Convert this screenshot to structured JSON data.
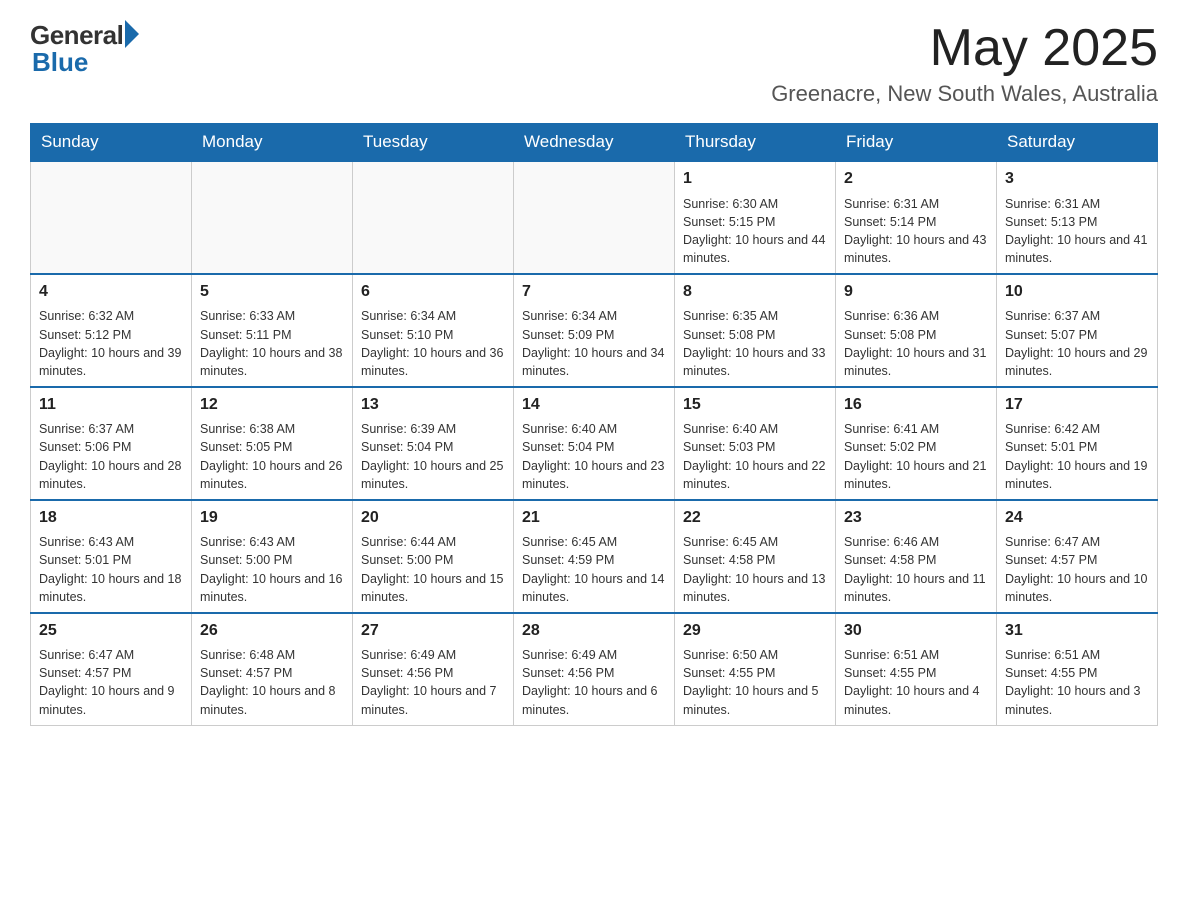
{
  "header": {
    "logo_general": "General",
    "logo_blue": "Blue",
    "month_title": "May 2025",
    "subtitle": "Greenacre, New South Wales, Australia"
  },
  "weekdays": [
    "Sunday",
    "Monday",
    "Tuesday",
    "Wednesday",
    "Thursday",
    "Friday",
    "Saturday"
  ],
  "weeks": [
    [
      {
        "day": "",
        "info": ""
      },
      {
        "day": "",
        "info": ""
      },
      {
        "day": "",
        "info": ""
      },
      {
        "day": "",
        "info": ""
      },
      {
        "day": "1",
        "info": "Sunrise: 6:30 AM\nSunset: 5:15 PM\nDaylight: 10 hours and 44 minutes."
      },
      {
        "day": "2",
        "info": "Sunrise: 6:31 AM\nSunset: 5:14 PM\nDaylight: 10 hours and 43 minutes."
      },
      {
        "day": "3",
        "info": "Sunrise: 6:31 AM\nSunset: 5:13 PM\nDaylight: 10 hours and 41 minutes."
      }
    ],
    [
      {
        "day": "4",
        "info": "Sunrise: 6:32 AM\nSunset: 5:12 PM\nDaylight: 10 hours and 39 minutes."
      },
      {
        "day": "5",
        "info": "Sunrise: 6:33 AM\nSunset: 5:11 PM\nDaylight: 10 hours and 38 minutes."
      },
      {
        "day": "6",
        "info": "Sunrise: 6:34 AM\nSunset: 5:10 PM\nDaylight: 10 hours and 36 minutes."
      },
      {
        "day": "7",
        "info": "Sunrise: 6:34 AM\nSunset: 5:09 PM\nDaylight: 10 hours and 34 minutes."
      },
      {
        "day": "8",
        "info": "Sunrise: 6:35 AM\nSunset: 5:08 PM\nDaylight: 10 hours and 33 minutes."
      },
      {
        "day": "9",
        "info": "Sunrise: 6:36 AM\nSunset: 5:08 PM\nDaylight: 10 hours and 31 minutes."
      },
      {
        "day": "10",
        "info": "Sunrise: 6:37 AM\nSunset: 5:07 PM\nDaylight: 10 hours and 29 minutes."
      }
    ],
    [
      {
        "day": "11",
        "info": "Sunrise: 6:37 AM\nSunset: 5:06 PM\nDaylight: 10 hours and 28 minutes."
      },
      {
        "day": "12",
        "info": "Sunrise: 6:38 AM\nSunset: 5:05 PM\nDaylight: 10 hours and 26 minutes."
      },
      {
        "day": "13",
        "info": "Sunrise: 6:39 AM\nSunset: 5:04 PM\nDaylight: 10 hours and 25 minutes."
      },
      {
        "day": "14",
        "info": "Sunrise: 6:40 AM\nSunset: 5:04 PM\nDaylight: 10 hours and 23 minutes."
      },
      {
        "day": "15",
        "info": "Sunrise: 6:40 AM\nSunset: 5:03 PM\nDaylight: 10 hours and 22 minutes."
      },
      {
        "day": "16",
        "info": "Sunrise: 6:41 AM\nSunset: 5:02 PM\nDaylight: 10 hours and 21 minutes."
      },
      {
        "day": "17",
        "info": "Sunrise: 6:42 AM\nSunset: 5:01 PM\nDaylight: 10 hours and 19 minutes."
      }
    ],
    [
      {
        "day": "18",
        "info": "Sunrise: 6:43 AM\nSunset: 5:01 PM\nDaylight: 10 hours and 18 minutes."
      },
      {
        "day": "19",
        "info": "Sunrise: 6:43 AM\nSunset: 5:00 PM\nDaylight: 10 hours and 16 minutes."
      },
      {
        "day": "20",
        "info": "Sunrise: 6:44 AM\nSunset: 5:00 PM\nDaylight: 10 hours and 15 minutes."
      },
      {
        "day": "21",
        "info": "Sunrise: 6:45 AM\nSunset: 4:59 PM\nDaylight: 10 hours and 14 minutes."
      },
      {
        "day": "22",
        "info": "Sunrise: 6:45 AM\nSunset: 4:58 PM\nDaylight: 10 hours and 13 minutes."
      },
      {
        "day": "23",
        "info": "Sunrise: 6:46 AM\nSunset: 4:58 PM\nDaylight: 10 hours and 11 minutes."
      },
      {
        "day": "24",
        "info": "Sunrise: 6:47 AM\nSunset: 4:57 PM\nDaylight: 10 hours and 10 minutes."
      }
    ],
    [
      {
        "day": "25",
        "info": "Sunrise: 6:47 AM\nSunset: 4:57 PM\nDaylight: 10 hours and 9 minutes."
      },
      {
        "day": "26",
        "info": "Sunrise: 6:48 AM\nSunset: 4:57 PM\nDaylight: 10 hours and 8 minutes."
      },
      {
        "day": "27",
        "info": "Sunrise: 6:49 AM\nSunset: 4:56 PM\nDaylight: 10 hours and 7 minutes."
      },
      {
        "day": "28",
        "info": "Sunrise: 6:49 AM\nSunset: 4:56 PM\nDaylight: 10 hours and 6 minutes."
      },
      {
        "day": "29",
        "info": "Sunrise: 6:50 AM\nSunset: 4:55 PM\nDaylight: 10 hours and 5 minutes."
      },
      {
        "day": "30",
        "info": "Sunrise: 6:51 AM\nSunset: 4:55 PM\nDaylight: 10 hours and 4 minutes."
      },
      {
        "day": "31",
        "info": "Sunrise: 6:51 AM\nSunset: 4:55 PM\nDaylight: 10 hours and 3 minutes."
      }
    ]
  ]
}
